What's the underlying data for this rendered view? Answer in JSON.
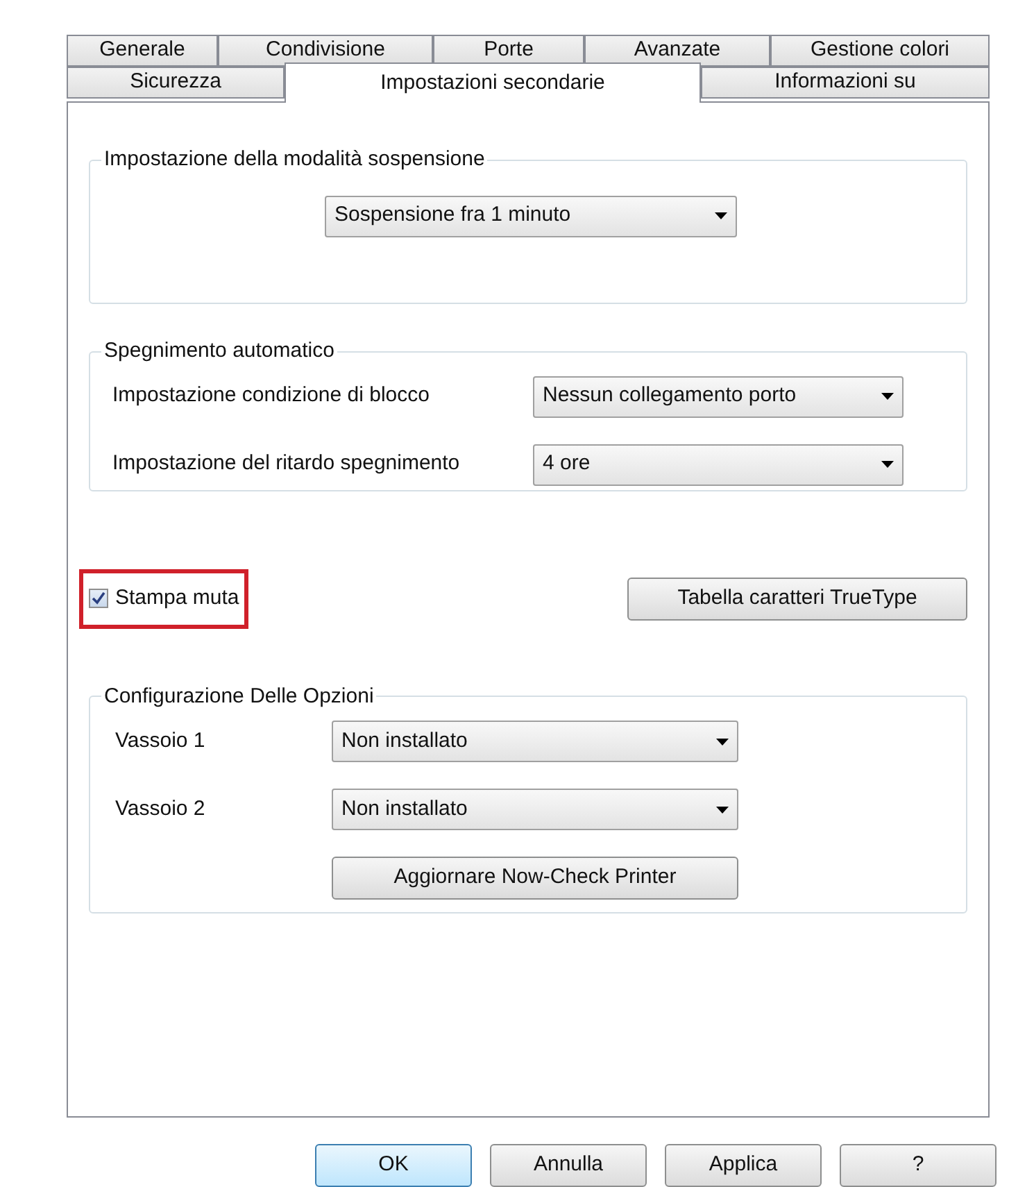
{
  "tab_rows": [
    [
      {
        "label": "Generale",
        "selected": false
      },
      {
        "label": "Condivisione",
        "selected": false
      },
      {
        "label": "Porte",
        "selected": false
      },
      {
        "label": "Avanzate",
        "selected": false
      },
      {
        "label": "Gestione colori",
        "selected": false
      }
    ],
    [
      {
        "label": "Sicurezza",
        "selected": false
      },
      {
        "label": "Impostazioni secondarie",
        "selected": true
      },
      {
        "label": "Informazioni su",
        "selected": false
      }
    ]
  ],
  "sleep_group": {
    "title": "Impostazione della modalità sospensione",
    "dropdown": "Sospensione fra 1 minuto"
  },
  "auto_off_group": {
    "title": "Spegnimento automatico",
    "rows": [
      {
        "label": "Impostazione condizione di blocco",
        "value": "Nessun collegamento porto"
      },
      {
        "label": "Impostazione del ritardo spegnimento",
        "value": "4 ore"
      }
    ]
  },
  "silent_print": {
    "label": "Stampa muta",
    "checked": true,
    "highlighted": true
  },
  "truetype_button": "Tabella caratteri TrueType",
  "options_group": {
    "title": "Configurazione Delle Opzioni",
    "rows": [
      {
        "label": "Vassoio 1",
        "value": "Non installato"
      },
      {
        "label": "Vassoio 2",
        "value": "Non installato"
      }
    ],
    "button": "Aggiornare Now-Check Printer"
  },
  "footer_buttons": [
    {
      "label": "OK",
      "kind": "default"
    },
    {
      "label": "Annulla",
      "kind": "normal"
    },
    {
      "label": "Applica",
      "kind": "normal"
    },
    {
      "label": "?",
      "kind": "normal"
    }
  ]
}
